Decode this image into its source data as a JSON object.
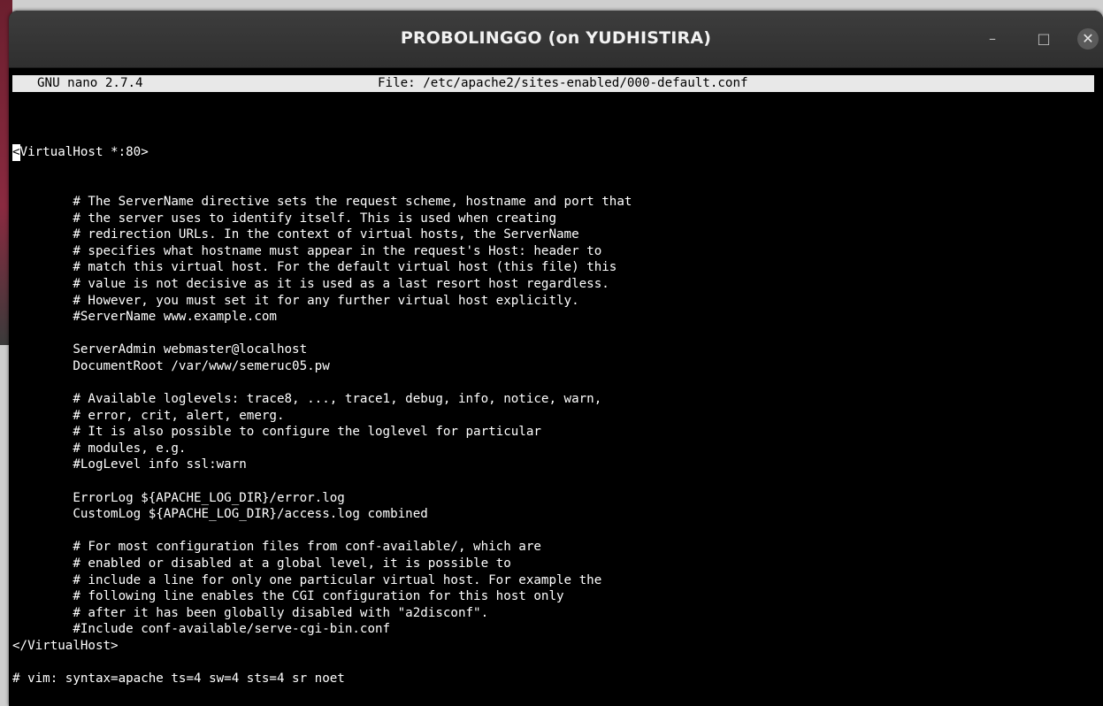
{
  "window": {
    "title": "PROBOLINGGO (on YUDHISTIRA)",
    "controls": {
      "minimize": "–",
      "maximize": "□",
      "close": "✕"
    }
  },
  "nano": {
    "version": "GNU nano 2.7.4",
    "file": "File: /etc/apache2/sites-enabled/000-default.conf"
  },
  "buffer": {
    "cursor_char": "<",
    "first_line_rest": "VirtualHost *:80>",
    "lines": [
      "        # The ServerName directive sets the request scheme, hostname and port that",
      "        # the server uses to identify itself. This is used when creating",
      "        # redirection URLs. In the context of virtual hosts, the ServerName",
      "        # specifies what hostname must appear in the request's Host: header to",
      "        # match this virtual host. For the default virtual host (this file) this",
      "        # value is not decisive as it is used as a last resort host regardless.",
      "        # However, you must set it for any further virtual host explicitly.",
      "        #ServerName www.example.com",
      "",
      "        ServerAdmin webmaster@localhost",
      "        DocumentRoot /var/www/semeruc05.pw",
      "",
      "        # Available loglevels: trace8, ..., trace1, debug, info, notice, warn,",
      "        # error, crit, alert, emerg.",
      "        # It is also possible to configure the loglevel for particular",
      "        # modules, e.g.",
      "        #LogLevel info ssl:warn",
      "",
      "        ErrorLog ${APACHE_LOG_DIR}/error.log",
      "        CustomLog ${APACHE_LOG_DIR}/access.log combined",
      "",
      "        # For most configuration files from conf-available/, which are",
      "        # enabled or disabled at a global level, it is possible to",
      "        # include a line for only one particular virtual host. For example the",
      "        # following line enables the CGI configuration for this host only",
      "        # after it has been globally disabled with \"a2disconf\".",
      "        #Include conf-available/serve-cgi-bin.conf",
      "</VirtualHost>",
      "",
      "# vim: syntax=apache ts=4 sw=4 sts=4 sr noet"
    ]
  }
}
